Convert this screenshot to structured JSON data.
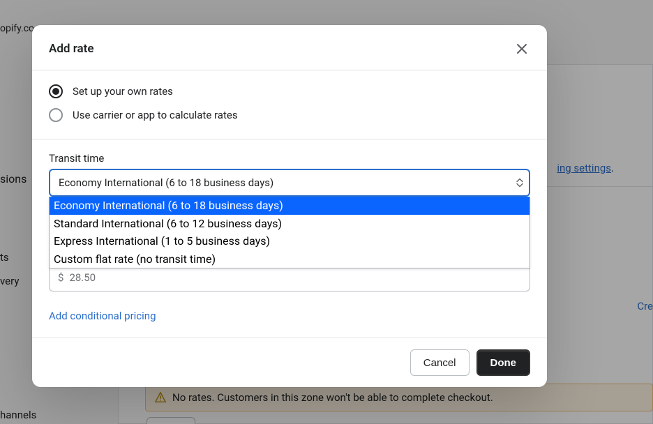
{
  "background": {
    "url_fragment": "opify.co",
    "sidebar_sions": "sions",
    "sidebar_ts": "ts",
    "sidebar_very": "very",
    "sidebar_hannels": "hannels",
    "settings_link": "ing settings",
    "settings_dot": ".",
    "create_fragment": "Cre",
    "warning_text": "No rates. Customers in this zone won't be able to complete checkout."
  },
  "modal": {
    "title": "Add rate",
    "radios": {
      "own_label": "Set up your own rates",
      "carrier_label": "Use carrier or app to calculate rates"
    },
    "transit_label": "Transit time",
    "select_value": "Economy International (6 to 18 business days)",
    "options": [
      "Economy International (6 to 18 business days)",
      "Standard International (6 to 12 business days)",
      "Express International (1 to 5 business days)",
      "Custom flat rate (no transit time)"
    ],
    "price_currency": "$",
    "price_value": "28.50",
    "cond_link": "Add conditional pricing",
    "cancel": "Cancel",
    "done": "Done"
  }
}
